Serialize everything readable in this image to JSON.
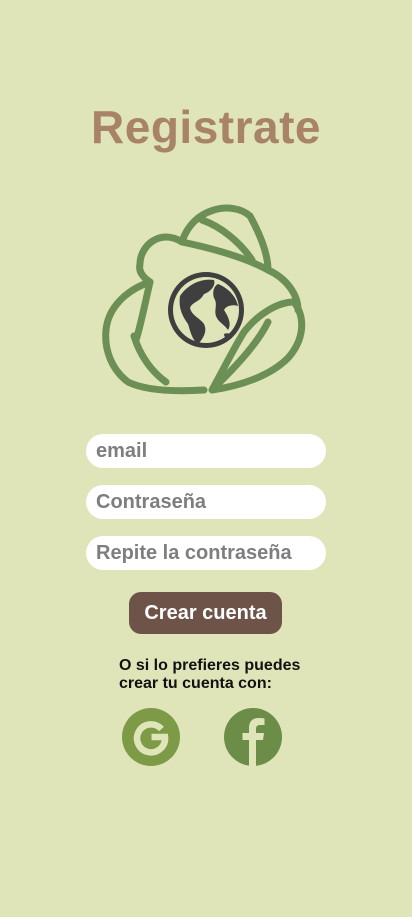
{
  "screen": {
    "title": "Registrate"
  },
  "form": {
    "email_placeholder": "email",
    "password_placeholder": "Contraseña",
    "repeat_password_placeholder": "Repite la contraseña",
    "create_button": "Crear cuenta"
  },
  "social": {
    "line1": "O si lo prefieres puedes",
    "line2": "crear tu cuenta con:",
    "google_icon": "google-icon",
    "facebook_icon": "facebook-icon"
  },
  "colors": {
    "background": "#dfe5b9",
    "title": "#a88367",
    "leaf": "#6b8f55",
    "globe": "#3f3f3f",
    "button": "#6e5448",
    "google": "#7d9a47",
    "facebook": "#6c8d48"
  }
}
